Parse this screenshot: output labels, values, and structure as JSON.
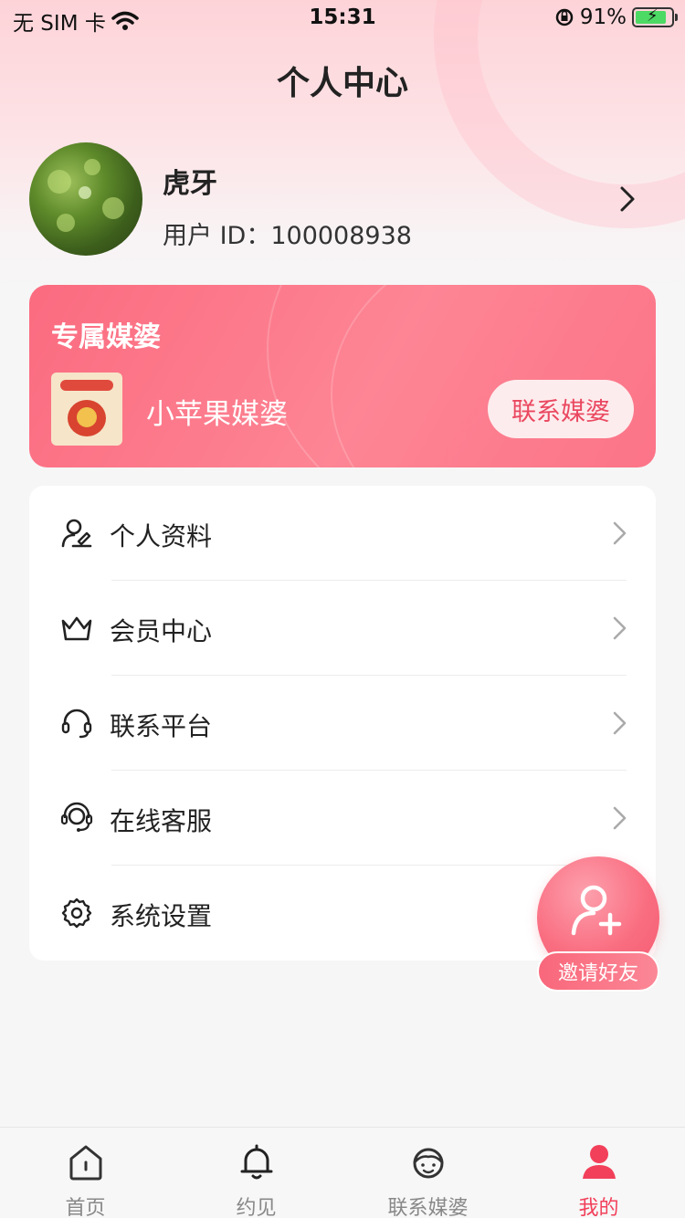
{
  "status_bar": {
    "carrier": "无 SIM 卡",
    "time": "15:31",
    "battery": "91%"
  },
  "header": {
    "title": "个人中心"
  },
  "profile": {
    "name": "虎牙",
    "user_id": "用户 ID：100008938"
  },
  "matchmaker": {
    "title": "专属媒婆",
    "name": "小苹果媒婆",
    "contact_label": "联系媒婆"
  },
  "menu": {
    "items": [
      {
        "label": "个人资料",
        "icon": "profile-edit-icon"
      },
      {
        "label": "会员中心",
        "icon": "crown-icon"
      },
      {
        "label": "联系平台",
        "icon": "headset-icon"
      },
      {
        "label": "在线客服",
        "icon": "customer-service-icon"
      },
      {
        "label": "系统设置",
        "icon": "gear-icon"
      }
    ]
  },
  "invite": {
    "label": "邀请好友"
  },
  "tabbar": {
    "tabs": [
      {
        "label": "首页",
        "icon": "home-icon"
      },
      {
        "label": "约见",
        "icon": "bell-icon"
      },
      {
        "label": "联系媒婆",
        "icon": "matchmaker-face-icon"
      },
      {
        "label": "我的",
        "icon": "person-icon"
      }
    ],
    "active_index": 3
  },
  "colors": {
    "accent": "#f2405a",
    "card_gradient_start": "#fb6b80",
    "card_gradient_end": "#fd8594"
  }
}
